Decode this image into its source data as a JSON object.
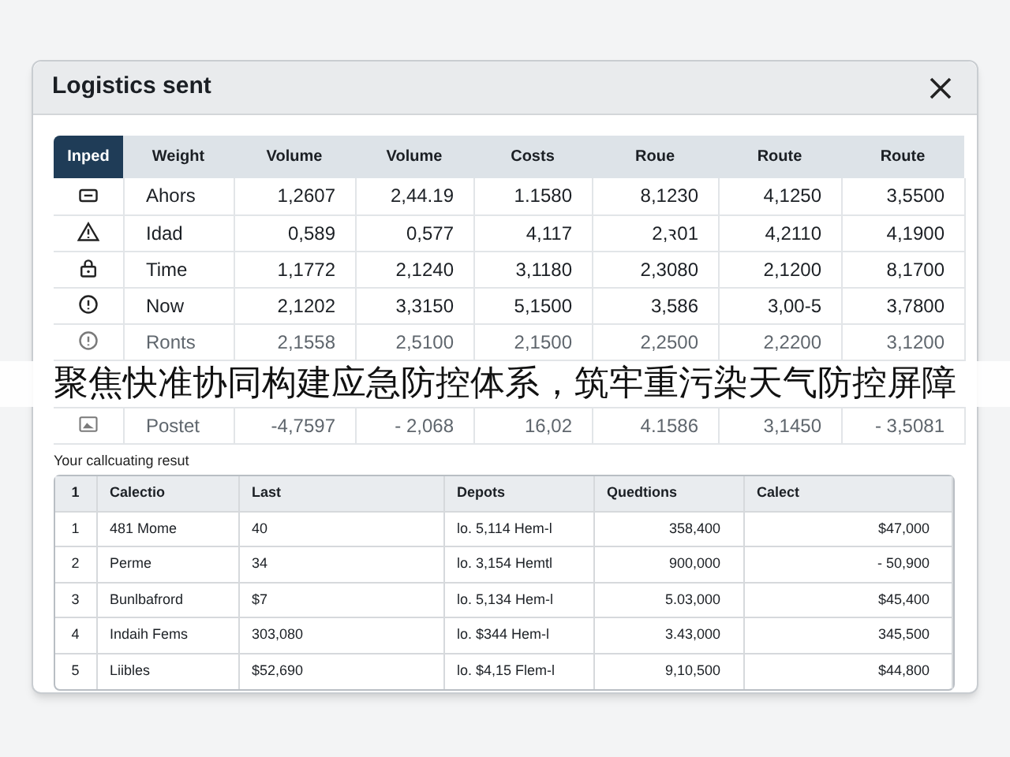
{
  "window": {
    "title": "Logistics sent"
  },
  "top_table": {
    "corner_label": "Inped",
    "columns": [
      "Weight",
      "Volume",
      "Volume",
      "Costs",
      "Roue",
      "Route",
      "Route"
    ],
    "rows": [
      {
        "kind": "card",
        "cells": [
          "Ahors",
          "1,2607",
          "2,44.19",
          "1.1580",
          "8,1230",
          "4,1250",
          "3,5500"
        ],
        "faded": false
      },
      {
        "kind": "warning",
        "cells": [
          "Idad",
          "0,589",
          "0,577",
          "4,117",
          "2,ꝛ01",
          "4,2110",
          "4,1900"
        ],
        "faded": false
      },
      {
        "kind": "lock",
        "cells": [
          "Time",
          "1,1772",
          "2,1240",
          "3,1180",
          "2,3080",
          "2,1200",
          "8,1700"
        ],
        "faded": false
      },
      {
        "kind": "info",
        "cells": [
          "Now",
          "2,1202",
          "3,3150",
          "5,1500",
          "3,586",
          "3,00-5",
          "3,7800"
        ],
        "faded": false
      },
      {
        "kind": "info",
        "cells": [
          "Ronts",
          "2,1558",
          "2,5100",
          "2,1500",
          "2,2500",
          "2,2200",
          "3,1200"
        ],
        "faded": true
      },
      {
        "kind": "image",
        "cells": [
          "Postet",
          "-4,7597",
          "- 2,068",
          "16,02",
          "4.1586",
          "3,1450",
          "- 3,5081"
        ],
        "faded": true
      }
    ]
  },
  "banner": {
    "text": "聚焦快准协同构建应急防控体系，筑牢重污染天气防控屏障"
  },
  "result_label": "Your callcuating resut",
  "result_table": {
    "columns": [
      "1",
      "Calectio",
      "Last",
      "Depots",
      "Quedtions",
      "Calect"
    ],
    "rows": [
      [
        "1",
        "481 Mome",
        "40",
        "lo. 5,114 Hem-l",
        "358,400",
        "$47,000"
      ],
      [
        "2",
        "Perme",
        "34",
        "lo. 3,154 Hemtl",
        "900,000",
        "- 50,900"
      ],
      [
        "3",
        "Bunlbafrord",
        "$7",
        "lo. 5,134 Hem-l",
        "5.03,000",
        "$45,400"
      ],
      [
        "4",
        "Indaih Fems",
        "303,080",
        "lo. $344 Hem-l",
        "3.43,000",
        "345,500"
      ],
      [
        "5",
        "Liibles",
        "$52,690",
        "lo. $4,15 Flem-l",
        "9,10,500",
        "$44,800"
      ]
    ]
  }
}
